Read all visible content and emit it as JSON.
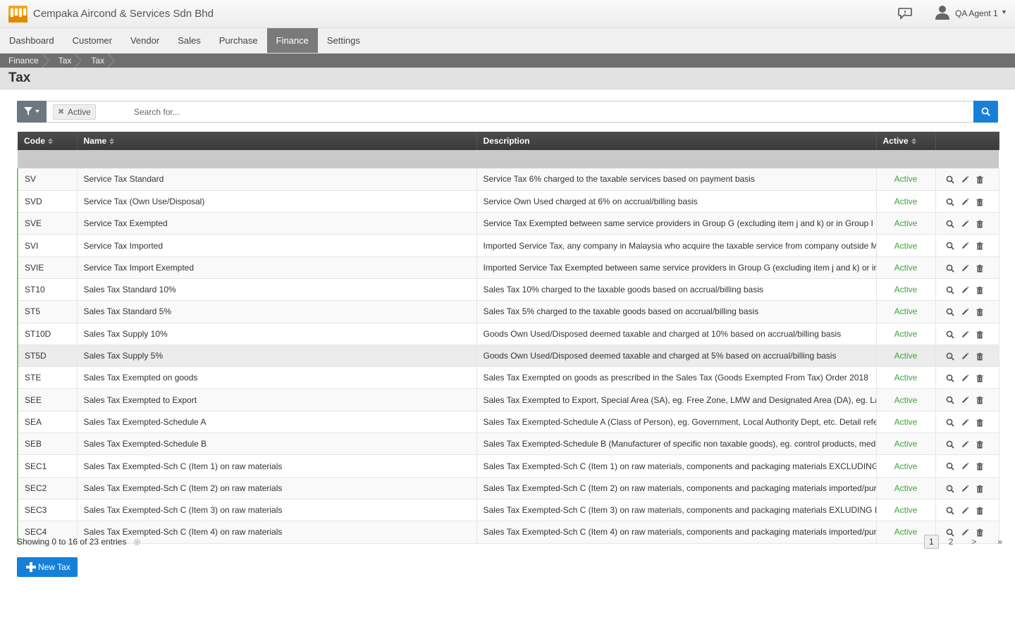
{
  "header": {
    "company": "Cempaka Aircond & Services Sdn Bhd",
    "user_name": "QA Agent 1",
    "icons": {
      "logo": "company-logo",
      "chat": "chat-icon",
      "avatar": "user-icon",
      "caret": "caret-down-icon"
    }
  },
  "nav": {
    "items": [
      {
        "label": "Dashboard"
      },
      {
        "label": "Customer"
      },
      {
        "label": "Vendor"
      },
      {
        "label": "Sales"
      },
      {
        "label": "Purchase"
      },
      {
        "label": "Finance",
        "active": true
      },
      {
        "label": "Settings"
      }
    ]
  },
  "breadcrumb": [
    "Finance",
    "Tax",
    "Tax"
  ],
  "page": {
    "title": "Tax"
  },
  "search": {
    "filter_tag": "Active",
    "placeholder": "Search for..."
  },
  "table": {
    "columns": [
      "Code",
      "Name",
      "Description",
      "Active",
      ""
    ],
    "rows": [
      {
        "code": "SV",
        "name": "Service Tax Standard",
        "description": "Service Tax 6% charged to the taxable services based on payment basis",
        "active": "Active"
      },
      {
        "code": "SVD",
        "name": "Service Tax (Own Use/Disposal)",
        "description": "Service Own Used charged at 6% on accrual/billing basis",
        "active": "Active"
      },
      {
        "code": "SVE",
        "name": "Service Tax Exempted",
        "description": "Service Tax Exempted between same service providers in Group G (excluding item j and k) or in Group I i",
        "active": "Active"
      },
      {
        "code": "SVI",
        "name": "Service Tax Imported",
        "description": "Imported Service Tax, any company in Malaysia who acquire the taxable service from company outside M",
        "active": "Active"
      },
      {
        "code": "SVIE",
        "name": "Service Tax Import Exempted",
        "description": "Imported Service Tax Exempted between same service providers in Group G (excluding item j and k) or ir",
        "active": "Active"
      },
      {
        "code": "ST10",
        "name": "Sales Tax Standard 10%",
        "description": "Sales Tax 10% charged to the taxable goods based on accrual/billing basis",
        "active": "Active"
      },
      {
        "code": "ST5",
        "name": "Sales Tax Standard 5%",
        "description": "Sales Tax 5% charged to the taxable goods based on accrual/billing basis",
        "active": "Active"
      },
      {
        "code": "ST10D",
        "name": "Sales Tax Supply 10%",
        "description": "Goods Own Used/Disposed deemed taxable and charged at 10% based on accrual/billing basis",
        "active": "Active"
      },
      {
        "code": "ST5D",
        "name": "Sales Tax Supply 5%",
        "description": "Goods Own Used/Disposed deemed taxable and charged at 5% based on accrual/billing basis",
        "active": "Active"
      },
      {
        "code": "STE",
        "name": "Sales Tax Exempted on goods",
        "description": "Sales Tax Exempted on goods as prescribed in the Sales Tax (Goods Exempted From Tax) Order 2018",
        "active": "Active"
      },
      {
        "code": "SEE",
        "name": "Sales Tax Exempted to Export",
        "description": "Sales Tax Exempted to Export, Special Area (SA), eg. Free Zone, LMW and Designated Area (DA), eg. La",
        "active": "Active"
      },
      {
        "code": "SEA",
        "name": "Sales Tax Exempted-Schedule A",
        "description": "Sales Tax Exempted-Schedule A (Class of Person), eg. Government, Local Authority Dept, etc. Detail refe",
        "active": "Active"
      },
      {
        "code": "SEB",
        "name": "Sales Tax Exempted-Schedule B",
        "description": "Sales Tax Exempted-Schedule B (Manufacturer of specific non taxable goods), eg. control products, medi",
        "active": "Active"
      },
      {
        "code": "SEC1",
        "name": "Sales Tax Exempted-Sch C (Item 1) on raw materials",
        "description": "Sales Tax Exempted-Sch C (Item 1) on raw materials, components and packaging materials EXCLUDING",
        "active": "Active"
      },
      {
        "code": "SEC2",
        "name": "Sales Tax Exempted-Sch C (Item 2) on raw materials",
        "description": "Sales Tax Exempted-Sch C (Item 2) on raw materials, components and packaging materials imported/pur",
        "active": "Active"
      },
      {
        "code": "SEC3",
        "name": "Sales Tax Exempted-Sch C (Item 3) on raw materials",
        "description": "Sales Tax Exempted-Sch C (Item 3) on raw materials, components and packaging materials EXLUDING I",
        "active": "Active"
      },
      {
        "code": "SEC4",
        "name": "Sales Tax Exempted-Sch C (Item 4) on raw materials",
        "description": "Sales Tax Exempted-Sch C (Item 4) on raw materials, components and packaging materials imported/pur",
        "active": "Active"
      }
    ],
    "row_icons": [
      "search-icon",
      "pencil-icon",
      "trash-icon"
    ]
  },
  "footer": {
    "showing": "Showing 0 to 16 of 23 entries",
    "pages": [
      "1",
      "2"
    ],
    "current_page": "1",
    "next": ">",
    "last": "»",
    "new_button": "New Tax"
  },
  "colors": {
    "accent": "#1680d8",
    "active_text": "#3aa63a",
    "header_dark": "#3f3f3f",
    "nav_active": "#7a7a7a"
  }
}
